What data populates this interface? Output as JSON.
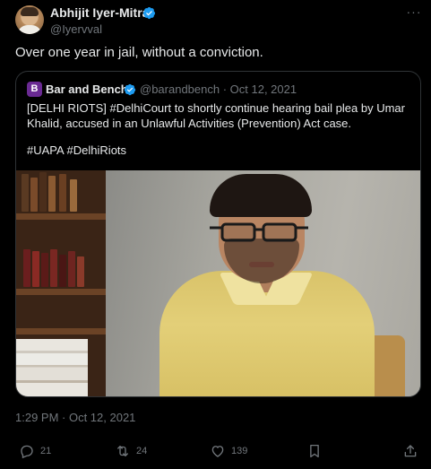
{
  "tweet": {
    "author": {
      "name": "Abhijit Iyer-Mitra",
      "handle": "@Iyervval",
      "avatar_icon": "user-avatar"
    },
    "text": "Over one year in jail, without a conviction.",
    "timestamp": "1:29 PM · Oct 12, 2021",
    "more_icon": "more-horizontal-icon"
  },
  "quote": {
    "logo_letter": "B",
    "logo_color": "#6a2a93",
    "name": "Bar and Bench",
    "meta": "@barandbench · Oct 12, 2021",
    "body_lines": [
      "[DELHI RIOTS] #DelhiCourt to shortly continue hearing bail plea by Umar",
      "Khalid, accused in an Unlawful Activities (Prevention) Act case."
    ],
    "hashtags": "#UAPA #DelhiRiots",
    "image_icon": "photo"
  },
  "actions": {
    "reply_count": "21",
    "retweet_count": "24",
    "like_count": "139"
  },
  "colors": {
    "background": "#000000",
    "text_primary": "#e7e9ea",
    "text_secondary": "#71767b",
    "verified": "#1d9bf0",
    "border": "#2f3336"
  }
}
